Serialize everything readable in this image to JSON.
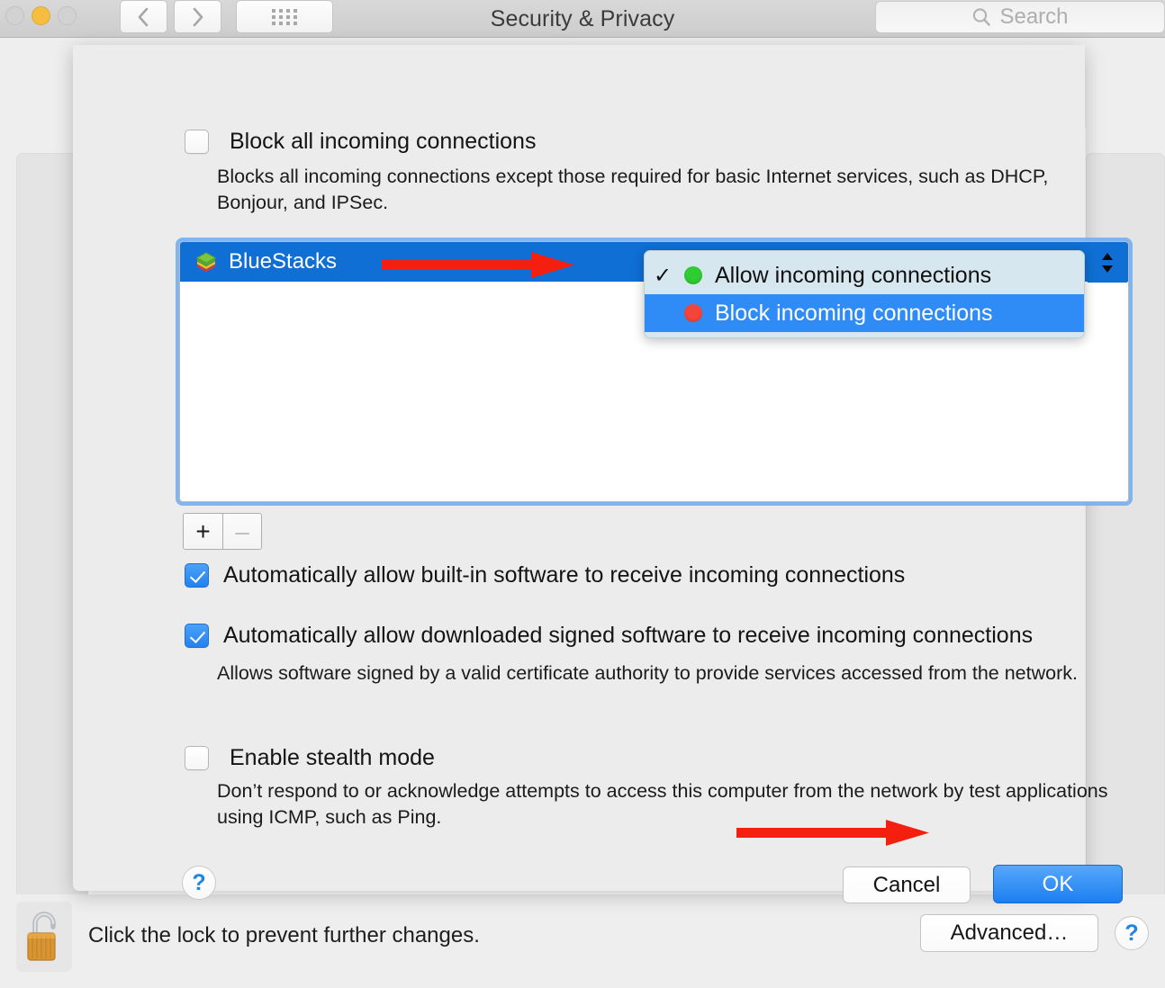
{
  "window": {
    "title": "Security & Privacy",
    "traffic_lights": [
      "close-button",
      "minimize-button",
      "zoom-button"
    ],
    "nav": {
      "back_icon": "chevron-left-icon",
      "forward_icon": "chevron-right-icon",
      "grid_icon": "show-all-grid-icon"
    },
    "search": {
      "placeholder": "Search",
      "value": "",
      "icon": "search-icon"
    }
  },
  "sheet": {
    "block_all": {
      "label": "Block all incoming connections",
      "checked": false,
      "description": "Blocks all incoming connections except those required for basic Internet services, such as DHCP, Bonjour, and IPSec."
    },
    "app_list": {
      "rows": [
        {
          "name": "BlueStacks",
          "icon": "bluestacks-app-icon",
          "selected": true,
          "setting": "Block incoming connections"
        }
      ],
      "add_label": "+",
      "remove_label": "–",
      "remove_disabled": true
    },
    "menu": {
      "open": true,
      "items": [
        {
          "label": "Allow incoming connections",
          "dot": "green",
          "dot_color": "#2fcc33",
          "checked": true,
          "highlighted": false
        },
        {
          "label": "Block incoming connections",
          "dot": "red",
          "dot_color": "#f5453a",
          "checked": false,
          "highlighted": true
        }
      ],
      "check_glyph": "✓"
    },
    "options": [
      {
        "label": "Automatically allow built-in software to receive incoming connections",
        "checked": true,
        "description": ""
      },
      {
        "label": "Automatically allow downloaded signed software to receive incoming connections",
        "checked": true,
        "description": "Allows software signed by a valid certificate authority to provide services accessed from the network."
      },
      {
        "label": "Enable stealth mode",
        "checked": false,
        "description": "Don’t respond to or acknowledge attempts to access this computer from the network by test applications using ICMP, such as Ping."
      }
    ],
    "buttons": {
      "help_label": "?",
      "cancel_label": "Cancel",
      "ok_label": "OK"
    }
  },
  "lock_bar": {
    "icon": "open-padlock-icon",
    "message": "Click the lock to prevent further changes.",
    "advanced_label": "Advanced…",
    "help_label": "?"
  },
  "annotations": {
    "arrow_color": "#f51f10",
    "arrows": [
      {
        "name": "arrow-pointing-to-block-incoming",
        "target": "menu-item-block"
      },
      {
        "name": "arrow-pointing-to-ok",
        "target": "ok-button"
      }
    ]
  },
  "colors": {
    "accent_blue": "#1c7ef0",
    "selection_blue": "#0f6fd4",
    "menu_highlight": "#2f8cf7",
    "sheet_bg": "#ececec",
    "window_bg": "#eeeeee"
  }
}
